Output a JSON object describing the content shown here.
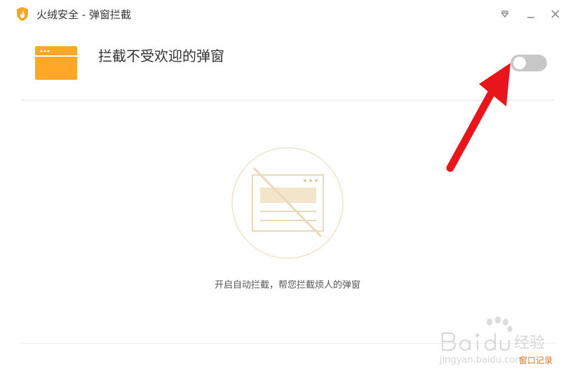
{
  "window": {
    "title": "火绒安全 - 弹窗拦截",
    "icons": {
      "app": "flame-shield-icon",
      "menu": "dropdown-triangle-icon",
      "minimize": "minimize-icon",
      "close": "close-icon"
    }
  },
  "feature": {
    "icon": "browser-window-icon",
    "title": "拦截不受欢迎的弹窗",
    "toggle_state": "off"
  },
  "empty_state": {
    "icon": "blocked-popup-icon",
    "hint": "开启自动拦截，帮您拦截烦人的弹窗"
  },
  "footer": {
    "link_label": "窗口记录"
  },
  "watermark": {
    "brand": "Bai du 经验",
    "url": "jingyan.baidu.com"
  },
  "colors": {
    "accent_orange": "#FFA726",
    "toggle_off": "#C7C7C7",
    "illustration_tan": "#EAD9B8",
    "link_orange": "#D4782A",
    "arrow_red": "#E8161B"
  }
}
